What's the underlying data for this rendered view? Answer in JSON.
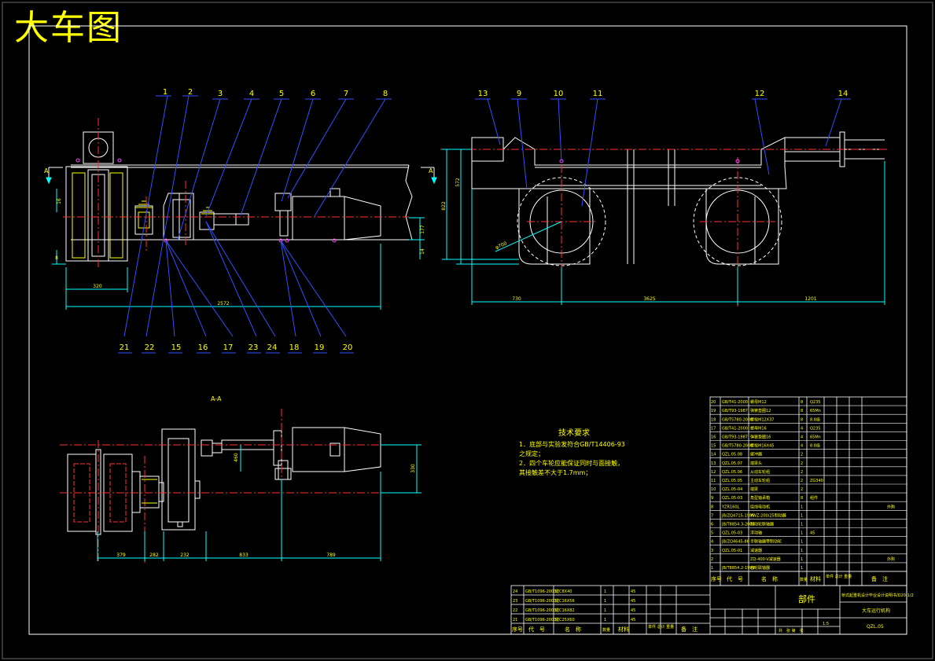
{
  "title": "大车图",
  "section_label": "A-A",
  "section_marker": "A",
  "part_numbers_top_left": [
    "1",
    "2",
    "3",
    "4",
    "5",
    "6",
    "7",
    "8"
  ],
  "part_numbers_bottom_left": [
    "21",
    "22",
    "15",
    "16",
    "17",
    "23",
    "24",
    "18",
    "19",
    "20"
  ],
  "part_numbers_top_right": [
    "13",
    "9",
    "10",
    "11",
    "12",
    "14"
  ],
  "dimensions": {
    "d320": "320",
    "d2572": "2572",
    "d16": "16",
    "d8": "8",
    "d177": "177",
    "d14": "14",
    "d572": "572",
    "d822": "822",
    "d700": "φ700",
    "d730": "730",
    "d3625": "3625",
    "d1201": "1201",
    "d379": "379",
    "d282": "282",
    "d232": "232",
    "d833": "833",
    "d789": "789",
    "d460": "460",
    "d330": "330"
  },
  "tech_requirements": {
    "heading": "技术要求",
    "lines": [
      "1．底部与实验发符合GB/T14406-93",
      "之规定；",
      "2．四个车轮应能保证同时与面接触，",
      "其接触差不大于1.7mm；"
    ]
  },
  "bom_rows": [
    {
      "no": "20",
      "code": "GB/T41-2000",
      "name": "螺母M12",
      "qty": "8",
      "mat": "Q235"
    },
    {
      "no": "19",
      "code": "GB/T93-1987",
      "name": "弹簧垫圈12",
      "qty": "8",
      "mat": "65Mn"
    },
    {
      "no": "18",
      "code": "GB/T5780-2000",
      "name": "螺栓M12X37",
      "qty": "8",
      "mat": "8.8级"
    },
    {
      "no": "17",
      "code": "GB/T41-2000",
      "name": "螺母M16",
      "qty": "4",
      "mat": "Q235"
    },
    {
      "no": "16",
      "code": "GB/T93-1987",
      "name": "弹簧垫圈16",
      "qty": "4",
      "mat": "65Mn"
    },
    {
      "no": "15",
      "code": "GB/T5780-2000",
      "name": "螺栓M16X45",
      "qty": "4",
      "mat": "8.8级"
    },
    {
      "no": "14",
      "code": "QZL.05.08",
      "name": "缓冲器",
      "qty": "2",
      "mat": ""
    },
    {
      "no": "13",
      "code": "QZL.05.07",
      "name": "端梁头",
      "qty": "2",
      "mat": ""
    },
    {
      "no": "12",
      "code": "QZL.05.06",
      "name": "从动车轮组",
      "qty": "2",
      "mat": ""
    },
    {
      "no": "11",
      "code": "QZL.05.05",
      "name": "主动车轮组",
      "qty": "2",
      "mat": "ZG340"
    },
    {
      "no": "10",
      "code": "QZL.05-04",
      "name": "端梁",
      "qty": "2",
      "mat": ""
    },
    {
      "no": "9",
      "code": "QZL.05-03",
      "name": "角型轴承箱",
      "qty": "8",
      "mat": "组件"
    },
    {
      "no": "8",
      "code": "YZR160L",
      "name": "绕线电动机",
      "qty": "1",
      "mat": ""
    },
    {
      "no": "7",
      "code": "JB/ZQ4715-1986",
      "name": "YWZ-200/25制动器",
      "qty": "1",
      "mat": ""
    },
    {
      "no": "6",
      "code": "JB/T8854.3-2000",
      "name": "制动轮联轴器",
      "qty": "1",
      "mat": ""
    },
    {
      "no": "5",
      "code": "QZL.05-03",
      "name": "浮动轴",
      "qty": "1",
      "mat": "45"
    },
    {
      "no": "4",
      "code": "JB/ZQ4645-86",
      "name": "半联轴器带制动轮",
      "qty": "1",
      "mat": ""
    },
    {
      "no": "3",
      "code": "QZL.05-01",
      "name": "减速器",
      "qty": "1",
      "mat": ""
    },
    {
      "no": "2",
      "code": "",
      "name": "ZQ-400-V减速器",
      "qty": "1",
      "mat": ""
    },
    {
      "no": "1",
      "code": "JB/T8854.2-1999",
      "name": "齿轮联轴器",
      "qty": "1",
      "mat": ""
    }
  ],
  "bom_extra_notes": [
    "外购",
    "外购"
  ],
  "bom_header": {
    "no": "序号",
    "code": "代　号",
    "name": "名　称",
    "qty": "数量",
    "mat": "材料",
    "wt": "单件 总计 重量",
    "rem": "备　注"
  },
  "small_bom_rows": [
    {
      "no": "24",
      "code": "GB/T1096-2003",
      "name": "键C8X40",
      "qty": "1",
      "mat": "45"
    },
    {
      "no": "23",
      "code": "GB/T1096-2003",
      "name": "键C16X56",
      "qty": "1",
      "mat": "45"
    },
    {
      "no": "22",
      "code": "GB/T1096-2003",
      "name": "键C16X82",
      "qty": "1",
      "mat": "45"
    },
    {
      "no": "21",
      "code": "GB/T1096-2003",
      "name": "键C25X60",
      "qty": "1",
      "mat": "45"
    }
  ],
  "title_block": {
    "part_label": "部件",
    "project": "桥式起重机设计毕业设计说明书/D20-1/2",
    "drawing_name": "大车运行机构",
    "drawing_no": "QZL.05",
    "scale": "1:5",
    "sheet": "共　张 第　张"
  }
}
